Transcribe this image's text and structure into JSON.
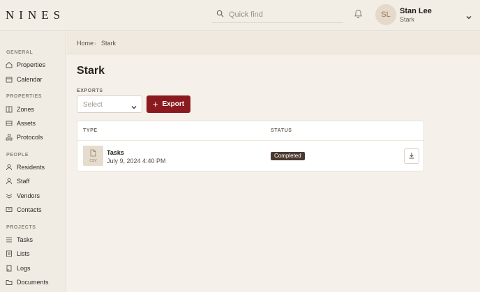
{
  "app": {
    "logo": "NINES",
    "search_placeholder": "Quick find"
  },
  "user": {
    "initials": "SL",
    "name": "Stan Lee",
    "org": "Stark"
  },
  "sidebar": {
    "sections": [
      {
        "label": "GENERAL"
      },
      {
        "label": "PROPERTIES"
      },
      {
        "label": "PEOPLE"
      },
      {
        "label": "PROJECTS"
      }
    ],
    "items": [
      {
        "label": "Properties",
        "icon": "properties-icon"
      },
      {
        "label": "Calendar",
        "icon": "calendar-icon"
      },
      {
        "label": "Zones",
        "icon": "zones-icon"
      },
      {
        "label": "Assets",
        "icon": "assets-icon"
      },
      {
        "label": "Protocols",
        "icon": "protocols-icon"
      },
      {
        "label": "Residents",
        "icon": "residents-icon"
      },
      {
        "label": "Staff",
        "icon": "staff-icon"
      },
      {
        "label": "Vendors",
        "icon": "vendors-icon"
      },
      {
        "label": "Contacts",
        "icon": "contacts-icon"
      },
      {
        "label": "Tasks",
        "icon": "tasks-icon"
      },
      {
        "label": "Lists",
        "icon": "lists-icon"
      },
      {
        "label": "Logs",
        "icon": "logs-icon"
      },
      {
        "label": "Documents",
        "icon": "documents-icon"
      }
    ]
  },
  "breadcrumb": {
    "items": [
      "Home",
      "Stark"
    ],
    "separator": "›"
  },
  "page": {
    "title": "Stark",
    "exports_label": "EXPORTS",
    "select_placeholder": "Select",
    "export_button": "Export",
    "export_button_plus": "+"
  },
  "table": {
    "headers": [
      "TYPE",
      "STATUS"
    ],
    "rows": [
      {
        "file_type": "CSV",
        "name": "Tasks",
        "date": "July 9, 2024 4:40 PM",
        "status": "Completed"
      }
    ]
  },
  "colors": {
    "accent": "#8b1a1f",
    "status_badge": "#4a3a30",
    "background": "#f5f1ea"
  }
}
